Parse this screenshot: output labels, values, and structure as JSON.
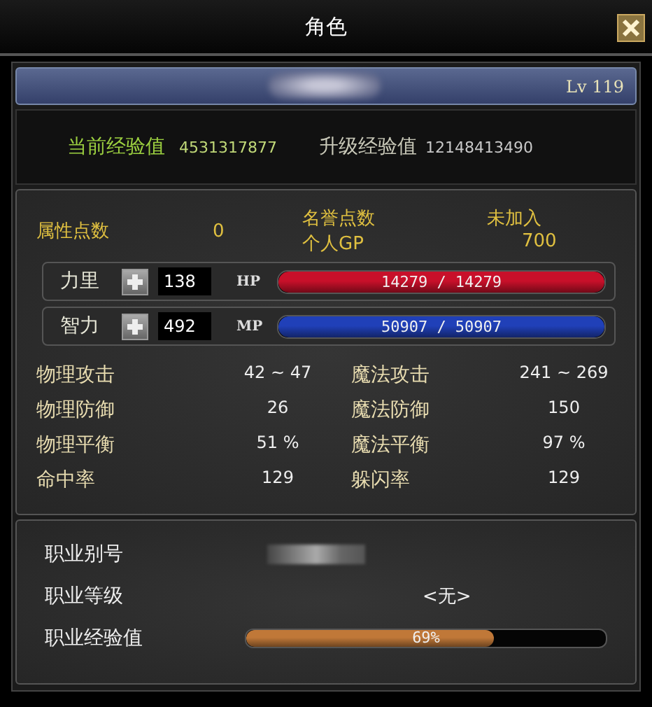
{
  "window": {
    "title": "角色"
  },
  "name_bar": {
    "level_label": "Lv 119"
  },
  "experience": {
    "current_label": "当前经验值",
    "current_value": "4531317877",
    "next_label": "升级经验值",
    "next_value": "12148413490"
  },
  "points": {
    "attribute_label": "属性点数",
    "attribute_value": "0",
    "honor_label": "名誉点数",
    "honor_value": "未加入",
    "gp_label": "个人GP",
    "gp_value": "700"
  },
  "attributes": [
    {
      "label": "力里",
      "value": "138",
      "bar_label": "HP",
      "reading": "14279 / 14279",
      "level": 1,
      "color": "#c8102a"
    },
    {
      "label": "智力",
      "value": "492",
      "bar_label": "MP",
      "reading": "50907 / 50907",
      "level": 1,
      "color": "#2040b8"
    }
  ],
  "stats": [
    {
      "label": "物理攻击",
      "value": "42 ~ 47"
    },
    {
      "label": "魔法攻击",
      "value": "241 ~ 269"
    },
    {
      "label": "物理防御",
      "value": "26"
    },
    {
      "label": "魔法防御",
      "value": "150"
    },
    {
      "label": "物理平衡",
      "value": "51 %"
    },
    {
      "label": "魔法平衡",
      "value": "97 %"
    },
    {
      "label": "命中率",
      "value": "129"
    },
    {
      "label": "躲闪率",
      "value": "129"
    }
  ],
  "job": {
    "alias_label": "职业别号",
    "level_label": "职业等级",
    "level_value": "<无>",
    "exp_label": "职业经验值",
    "exp_bar": {
      "level": 0.69,
      "reading": "69%"
    }
  }
}
